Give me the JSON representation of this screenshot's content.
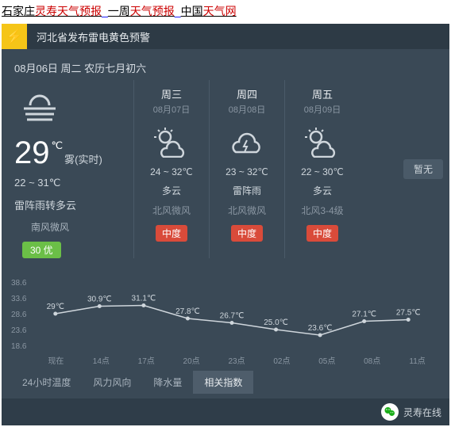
{
  "breadcrumb": {
    "p1a": "石家庄",
    "p1b": "灵寿天气预报",
    "sep1": "_",
    "p2a": "一周",
    "p2b": "天气预报",
    "sep2": "_",
    "p3a": "中国",
    "p3b": "天气网"
  },
  "alert": {
    "icon": "⚡",
    "text": "河北省发布雷电黄色预警"
  },
  "today": {
    "dateLine": "08月06日 周二 农历七月初六",
    "temp": "29",
    "unit": "℃",
    "condNow": "雾(实时)",
    "range": "22 ~ 31℃",
    "desc": "雷阵雨转多云",
    "wind": "南风微风",
    "aqi": "30 优"
  },
  "days": [
    {
      "name": "周三",
      "date": "08月07日",
      "range": "24 ~ 32℃",
      "cond": "多云",
      "wind": "北风微风",
      "aqi": "中度",
      "icon": "partly"
    },
    {
      "name": "周四",
      "date": "08月08日",
      "range": "23 ~ 32℃",
      "cond": "雷阵雨",
      "wind": "北风微风",
      "aqi": "中度",
      "icon": "thunder"
    },
    {
      "name": "周五",
      "date": "08月09日",
      "range": "22 ~ 30℃",
      "cond": "多云",
      "wind": "北风3-4级",
      "aqi": "中度",
      "icon": "partly"
    }
  ],
  "noneBtn": "暂无",
  "chart_data": {
    "type": "line",
    "title": "",
    "xlabel": "",
    "ylabel": "",
    "ylim": [
      18.6,
      38.6
    ],
    "y_ticks": [
      "38.6",
      "33.6",
      "28.6",
      "23.6",
      "18.6"
    ],
    "categories": [
      "现在",
      "14点",
      "17点",
      "20点",
      "23点",
      "02点",
      "05点",
      "08点",
      "11点"
    ],
    "values": [
      29,
      30.9,
      31.1,
      27.8,
      26.7,
      25.0,
      23.6,
      27.1,
      27.5
    ],
    "labels": [
      "29℃",
      "30.9℃",
      "31.1℃",
      "27.8℃",
      "26.7℃",
      "25.0℃",
      "23.6℃",
      "27.1℃",
      "27.5℃"
    ]
  },
  "tabs": [
    "24小时温度",
    "风力风向",
    "降水量",
    "相关指数"
  ],
  "activeTab": 3,
  "footer": {
    "source": "灵寿在线"
  }
}
